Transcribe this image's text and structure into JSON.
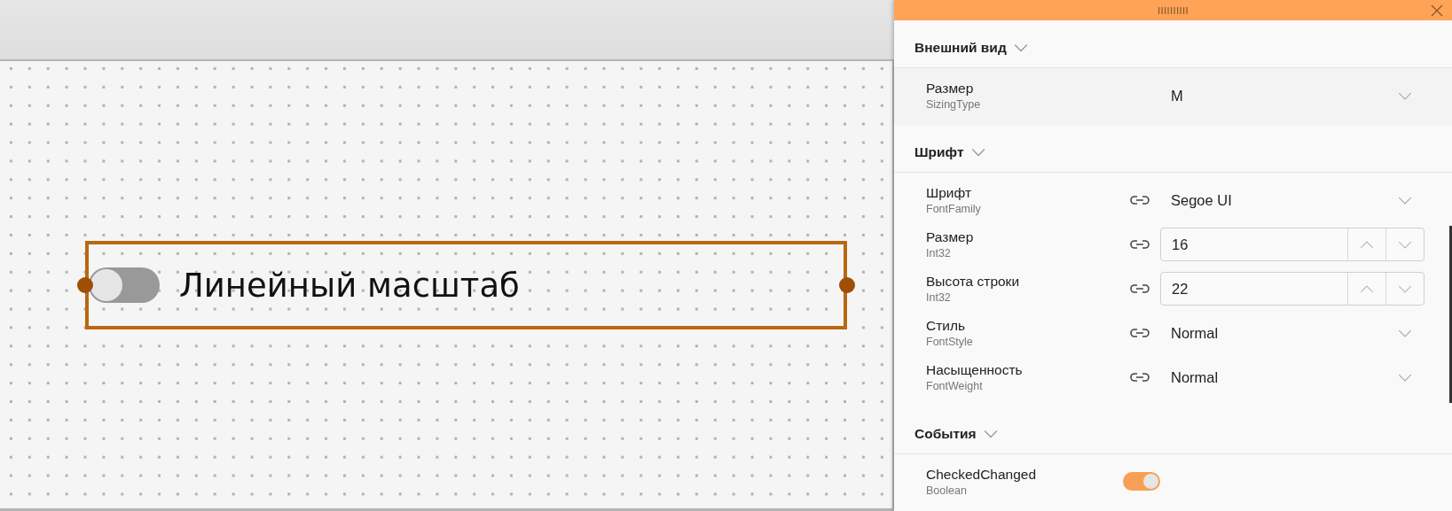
{
  "canvas": {
    "selected": true,
    "toggle": {
      "on": false,
      "label": "Линейный масштаб"
    }
  },
  "panel": {
    "sections": [
      {
        "title": "Внешний вид",
        "expanded": true,
        "shaded": true,
        "properties": [
          {
            "name": "Размер",
            "type": "SizingType",
            "kind": "dropdown",
            "linkable": false,
            "value": "M"
          }
        ]
      },
      {
        "title": "Шрифт",
        "expanded": true,
        "shaded": false,
        "properties": [
          {
            "name": "Шрифт",
            "type": "FontFamily",
            "kind": "dropdown",
            "linkable": true,
            "value": "Segoe UI"
          },
          {
            "name": "Размер",
            "type": "Int32",
            "kind": "number",
            "linkable": true,
            "value": "16"
          },
          {
            "name": "Высота строки",
            "type": "Int32",
            "kind": "number",
            "linkable": true,
            "value": "22"
          },
          {
            "name": "Стиль",
            "type": "FontStyle",
            "kind": "dropdown",
            "linkable": true,
            "value": "Normal"
          },
          {
            "name": "Насыщенность",
            "type": "FontWeight",
            "kind": "dropdown",
            "linkable": true,
            "value": "Normal"
          }
        ]
      },
      {
        "title": "События",
        "expanded": true,
        "shaded": false,
        "properties": [
          {
            "name": "CheckedChanged",
            "type": "Boolean",
            "kind": "toggle",
            "on": true
          }
        ]
      }
    ]
  }
}
